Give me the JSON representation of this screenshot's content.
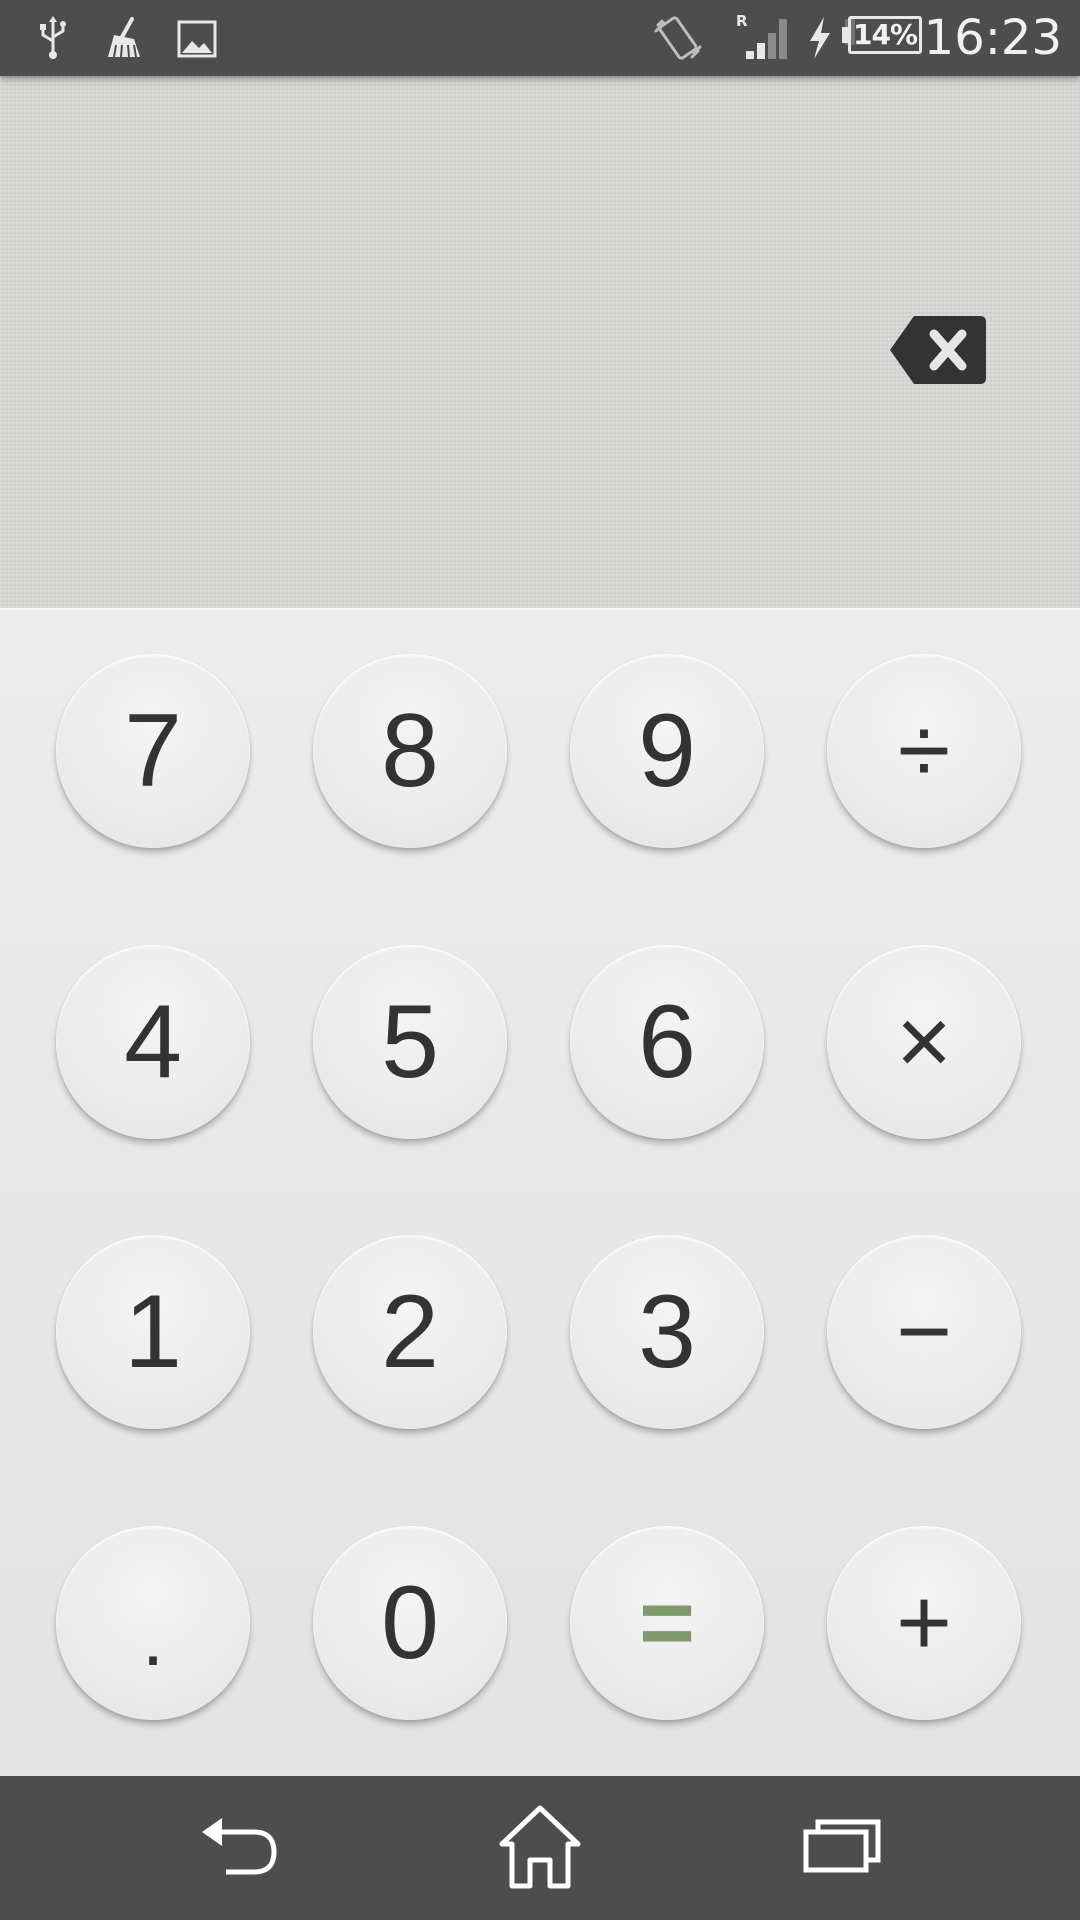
{
  "status_bar": {
    "icons": [
      "usb-icon",
      "cleaner-broom-icon",
      "image-notification-icon",
      "vibrate-icon",
      "roaming-icon",
      "signal-icon",
      "charging-bolt-icon"
    ],
    "roaming_label": "R",
    "battery_percent": "14%",
    "battery_level": 0.14,
    "time": "16:23"
  },
  "display": {
    "expression": "",
    "backspace_icon": "backspace-icon"
  },
  "keypad": {
    "rows": [
      [
        {
          "label": "7",
          "name": "key-7"
        },
        {
          "label": "8",
          "name": "key-8"
        },
        {
          "label": "9",
          "name": "key-9"
        },
        {
          "label": "÷",
          "name": "key-divide"
        }
      ],
      [
        {
          "label": "4",
          "name": "key-4"
        },
        {
          "label": "5",
          "name": "key-5"
        },
        {
          "label": "6",
          "name": "key-6"
        },
        {
          "label": "×",
          "name": "key-multiply"
        }
      ],
      [
        {
          "label": "1",
          "name": "key-1"
        },
        {
          "label": "2",
          "name": "key-2"
        },
        {
          "label": "3",
          "name": "key-3"
        },
        {
          "label": "−",
          "name": "key-subtract"
        }
      ],
      [
        {
          "label": ".",
          "name": "key-decimal"
        },
        {
          "label": "0",
          "name": "key-0"
        },
        {
          "label": "=",
          "name": "key-equals"
        },
        {
          "label": "+",
          "name": "key-add"
        }
      ]
    ],
    "equals_color": "#7d9a6a"
  },
  "nav_bar": {
    "buttons": [
      "back-icon",
      "home-icon",
      "recent-apps-icon"
    ]
  }
}
